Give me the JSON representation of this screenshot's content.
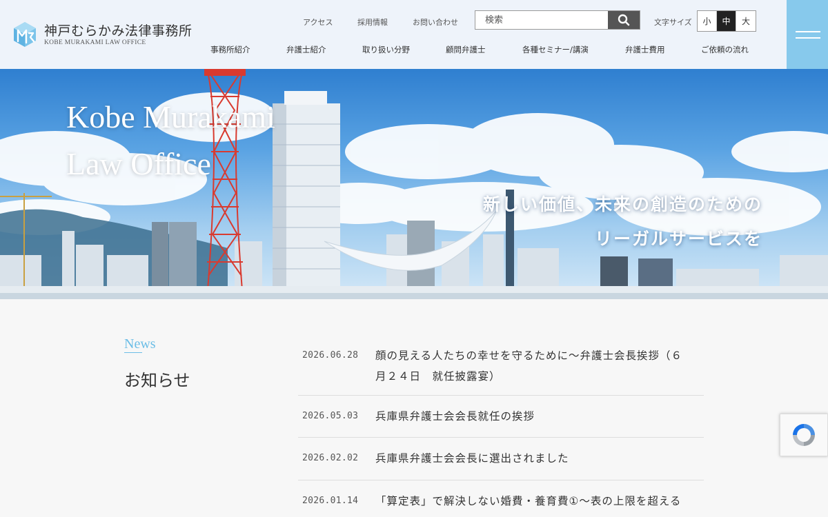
{
  "logo": {
    "name_jp": "神戸むらかみ法律事務所",
    "name_en": "KOBE MURAKAMI LAW OFFICE"
  },
  "utility_links": [
    "アクセス",
    "採用情報",
    "お問い合わせ"
  ],
  "search": {
    "placeholder": "検索",
    "icon": "search-icon"
  },
  "font_size": {
    "label": "文字サイズ",
    "options": [
      "小",
      "中",
      "大"
    ],
    "selected": "中"
  },
  "nav": [
    "事務所紹介",
    "弁護士紹介",
    "取り扱い分野",
    "顧問弁護士",
    "各種セミナー/講演",
    "弁護士費用",
    "ご依頼の流れ"
  ],
  "menu": {
    "icon": "hamburger-menu-icon"
  },
  "colors": {
    "accent": "#87c9ec",
    "news_accent": "#6bbde6",
    "header_bg": "#eef3fa",
    "tower": "#d93a2f"
  },
  "hero": {
    "title_line1": "Kobe Murakami",
    "title_line2": "Law Office",
    "catch_line1": "新しい価値、未来の創造のための",
    "catch_line2": "リーガルサービスを"
  },
  "news": {
    "heading_en": "News",
    "heading_jp": "お知らせ",
    "items": [
      {
        "date": "2026.06.28",
        "title_line1": "顔の見える人たちの幸せを守るために～弁護士会長挨拶（６",
        "title_line2": "月２４日　就任披露宴）"
      },
      {
        "date": "2026.05.03",
        "title_line1": "兵庫県弁護士会会長就任の挨拶",
        "title_line2": ""
      },
      {
        "date": "2026.02.02",
        "title_line1": "兵庫県弁護士会会長に選出されました",
        "title_line2": ""
      },
      {
        "date": "2026.01.14",
        "title_line1": "「算定表」で解決しない婚費・養育費①～表の上限を超える",
        "title_line2": ""
      }
    ]
  },
  "recaptcha": {
    "icon": "recaptcha-icon"
  }
}
